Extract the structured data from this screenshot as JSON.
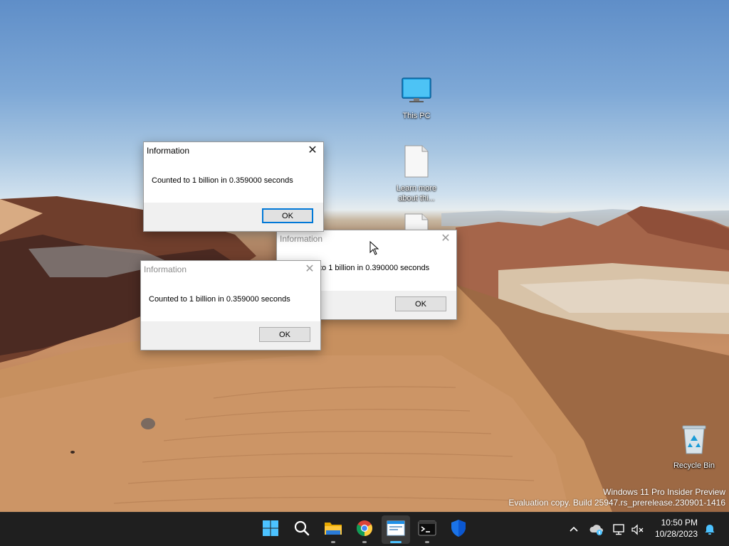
{
  "desktop": {
    "icons": [
      {
        "label": "This PC",
        "icon": "monitor-icon"
      },
      {
        "label": "Learn more about thi...",
        "icon": "document-icon"
      },
      {
        "label": "",
        "icon": "document-icon"
      },
      {
        "label": "Recycle Bin",
        "icon": "recycle-bin-icon"
      }
    ],
    "watermark": {
      "line1": "Windows 11 Pro Insider Preview",
      "line2": "Evaluation copy. Build 25947.rs_prerelease.230901-1416"
    }
  },
  "dialogs": [
    {
      "title": "Information",
      "message": "Counted to 1 billion in 0.359000 seconds",
      "ok_label": "OK",
      "state": "active"
    },
    {
      "title": "Information",
      "message": "to 1 billion in 0.390000 seconds",
      "ok_label": "OK",
      "state": "inactive"
    },
    {
      "title": "Information",
      "message": "Counted to 1 billion in 0.359000 seconds",
      "ok_label": "OK",
      "state": "inactive"
    }
  ],
  "taskbar": {
    "apps": [
      {
        "name": "Start",
        "icon": "windows-start-icon"
      },
      {
        "name": "Search",
        "icon": "search-icon"
      },
      {
        "name": "File Explorer",
        "icon": "folder-icon"
      },
      {
        "name": "Google Chrome",
        "icon": "chrome-icon"
      },
      {
        "name": "Application",
        "icon": "window-app-icon"
      },
      {
        "name": "Terminal",
        "icon": "terminal-icon"
      },
      {
        "name": "Windows Security",
        "icon": "shield-icon"
      }
    ],
    "tray": {
      "time": "10:50 PM",
      "date": "10/28/2023"
    }
  },
  "colors": {
    "taskbar_bg": "#1f1f1f",
    "accent": "#0078d7",
    "active_indicator": "#4cc2ff"
  }
}
